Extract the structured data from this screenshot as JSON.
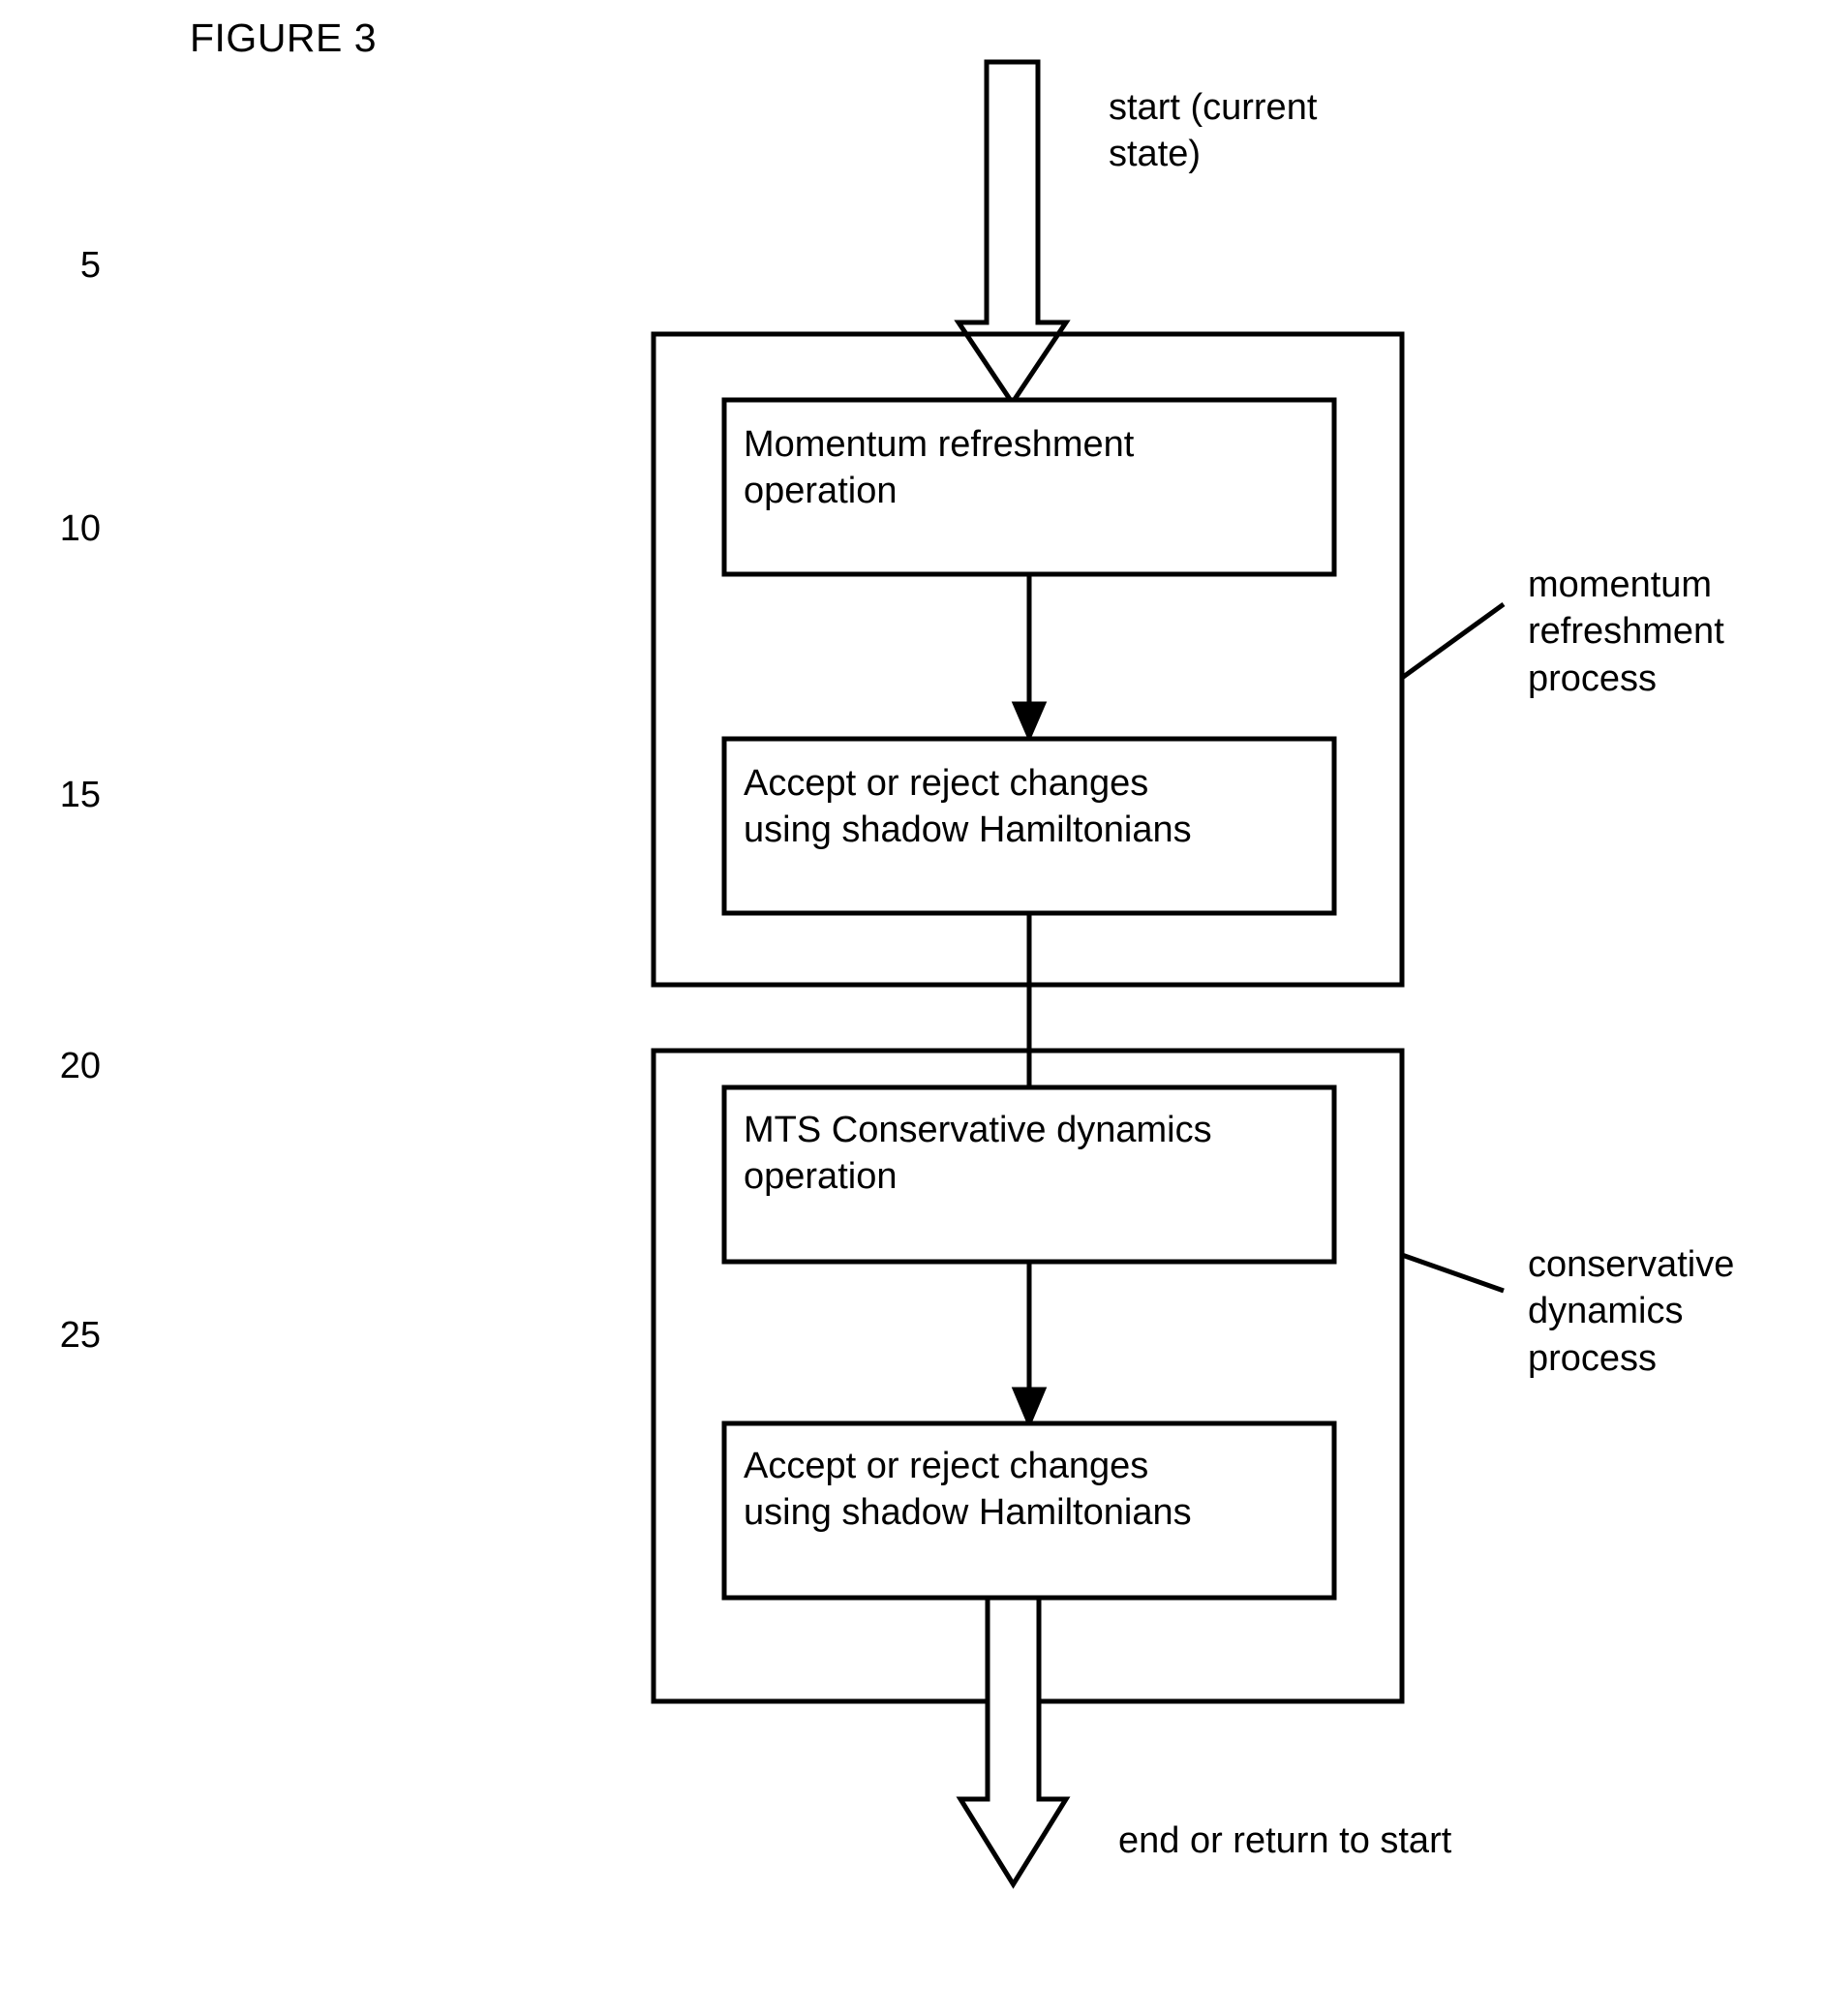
{
  "figure": {
    "title": "FIGURE 3"
  },
  "line_numbers": [
    "5",
    "10",
    "15",
    "20",
    "25"
  ],
  "flow": {
    "start_label": "start (current\nstate)",
    "end_label": "end or return to start"
  },
  "groups": [
    {
      "id": "momentum-refreshment-process",
      "callout": "momentum\nrefreshment\nprocess",
      "steps": [
        {
          "id": "momentum-refreshment-operation",
          "label": "Momentum refreshment\noperation"
        },
        {
          "id": "accept-reject-shadow-hamiltonians-1",
          "label": "Accept or reject changes\nusing shadow Hamiltonians"
        }
      ]
    },
    {
      "id": "conservative-dynamics-process",
      "callout": "conservative\ndynamics\nprocess",
      "steps": [
        {
          "id": "mts-conservative-dynamics-operation",
          "label": "MTS Conservative dynamics\noperation"
        },
        {
          "id": "accept-reject-shadow-hamiltonians-2",
          "label": "Accept or reject changes\nusing shadow Hamiltonians"
        }
      ]
    }
  ],
  "colors": {
    "stroke": "#000000",
    "background": "#ffffff",
    "text": "#000000"
  }
}
